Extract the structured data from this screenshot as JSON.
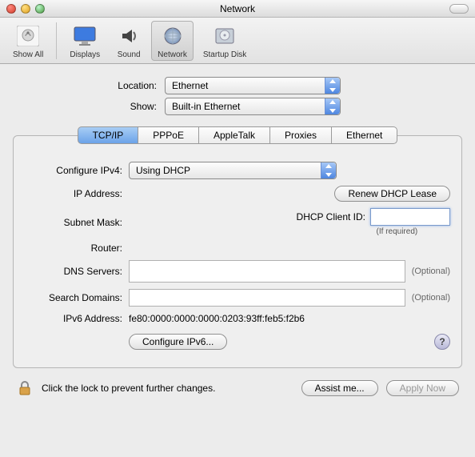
{
  "window": {
    "title": "Network"
  },
  "toolbar": {
    "items": [
      {
        "label": "Show All"
      },
      {
        "label": "Displays"
      },
      {
        "label": "Sound"
      },
      {
        "label": "Network"
      },
      {
        "label": "Startup Disk"
      }
    ]
  },
  "top": {
    "location_label": "Location:",
    "location_value": "Ethernet",
    "show_label": "Show:",
    "show_value": "Built-in Ethernet"
  },
  "tabs": [
    "TCP/IP",
    "PPPoE",
    "AppleTalk",
    "Proxies",
    "Ethernet"
  ],
  "tcpip": {
    "configure_label": "Configure IPv4:",
    "configure_value": "Using DHCP",
    "ip_label": "IP Address:",
    "ip_value": "",
    "renew_label": "Renew DHCP Lease",
    "subnet_label": "Subnet Mask:",
    "subnet_value": "",
    "dhcp_client_label": "DHCP Client ID:",
    "dhcp_client_value": "",
    "dhcp_client_note": "(If required)",
    "router_label": "Router:",
    "router_value": "",
    "dns_label": "DNS Servers:",
    "dns_value": "",
    "dns_opt": "(Optional)",
    "search_label": "Search Domains:",
    "search_value": "",
    "search_opt": "(Optional)",
    "ipv6addr_label": "IPv6 Address:",
    "ipv6addr_value": "fe80:0000:0000:0000:0203:93ff:feb5:f2b6",
    "configure_ipv6_label": "Configure IPv6...",
    "help_glyph": "?"
  },
  "bottom": {
    "lock_text": "Click the lock to prevent further changes.",
    "assist_label": "Assist me...",
    "apply_label": "Apply Now"
  }
}
